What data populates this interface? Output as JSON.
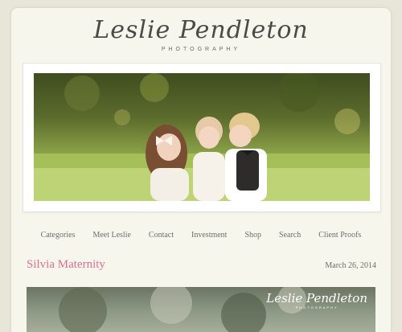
{
  "site": {
    "logo_script": "Leslie Pendleton",
    "logo_sub": "PHOTOGRAPHY"
  },
  "nav": {
    "items": [
      "Categories",
      "Meet Leslie",
      "Contact",
      "Investment",
      "Shop",
      "Search",
      "Client Proofs"
    ]
  },
  "post": {
    "title": "Silvia Maternity",
    "date": "March 26, 2014",
    "watermark_script": "Leslie Pendleton",
    "watermark_sub": "PHOTOGRAPHY"
  },
  "colors": {
    "accent": "#e46f86",
    "background": "#e8e6d9",
    "panel": "#f6f6ec",
    "text": "#6f6f69"
  }
}
